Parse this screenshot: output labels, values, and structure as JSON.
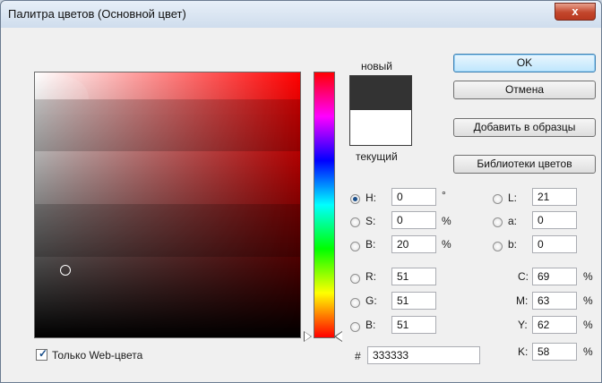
{
  "window": {
    "title": "Палитра цветов (Основной цвет)",
    "close_glyph": "x"
  },
  "swatch": {
    "new_label": "новый",
    "current_label": "текущий",
    "new_color": "#333333",
    "current_color": "#ffffff"
  },
  "buttons": {
    "ok": "OK",
    "cancel": "Отмена",
    "add_swatch": "Добавить в образцы",
    "libraries": "Библиотеки цветов"
  },
  "hsb": [
    {
      "label": "H:",
      "value": "0",
      "unit": "°",
      "checked": true
    },
    {
      "label": "S:",
      "value": "0",
      "unit": "%",
      "checked": false
    },
    {
      "label": "B:",
      "value": "20",
      "unit": "%",
      "checked": false
    }
  ],
  "rgb": [
    {
      "label": "R:",
      "value": "51"
    },
    {
      "label": "G:",
      "value": "51"
    },
    {
      "label": "B:",
      "value": "51"
    }
  ],
  "lab": [
    {
      "label": "L:",
      "value": "21"
    },
    {
      "label": "a:",
      "value": "0"
    },
    {
      "label": "b:",
      "value": "0"
    }
  ],
  "cmyk": [
    {
      "label": "C:",
      "value": "69",
      "unit": "%"
    },
    {
      "label": "M:",
      "value": "63",
      "unit": "%"
    },
    {
      "label": "Y:",
      "value": "62",
      "unit": "%"
    },
    {
      "label": "K:",
      "value": "58",
      "unit": "%"
    }
  ],
  "hex": {
    "label": "#",
    "value": "333333"
  },
  "web_only": {
    "label": "Только Web-цвета",
    "checked": true
  },
  "colors": {
    "accent": "#3c7fb1",
    "hue_reference": "#ff0000"
  }
}
